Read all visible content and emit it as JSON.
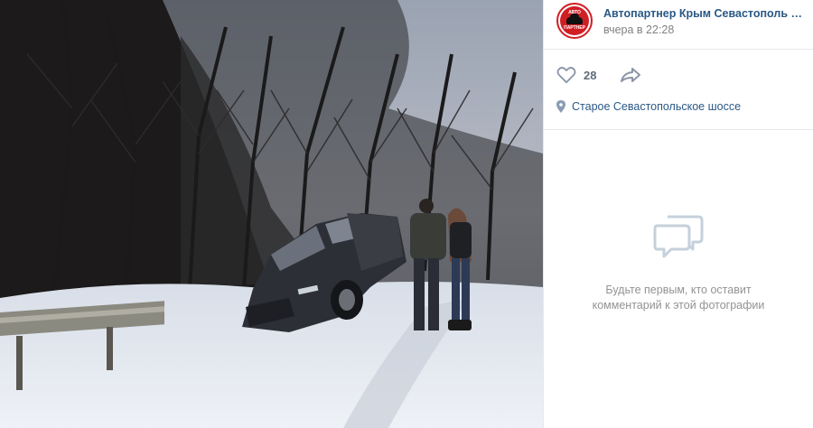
{
  "photo": {
    "description_icon": "photo"
  },
  "post": {
    "author": "Автопартнер Крым Севастополь Д...",
    "time": "вчера в 22:28",
    "avatar_icon": "car-logo-icon",
    "avatar_text_top": "АВТО",
    "avatar_text_bottom": "ПАРТНЕР"
  },
  "actions": {
    "like_count": "28",
    "like_icon": "heart-icon",
    "share_icon": "share-arrow-icon"
  },
  "location": {
    "icon": "location-pin-icon",
    "text": "Старое Севастопольское шоссе"
  },
  "comments": {
    "icon": "comment-bubbles-icon",
    "empty_line1": "Будьте первым, кто оставит",
    "empty_line2": "комментарий к этой фотографии"
  },
  "colors": {
    "link": "#2a5885",
    "muted": "#828282",
    "brand": "#d01f24"
  }
}
